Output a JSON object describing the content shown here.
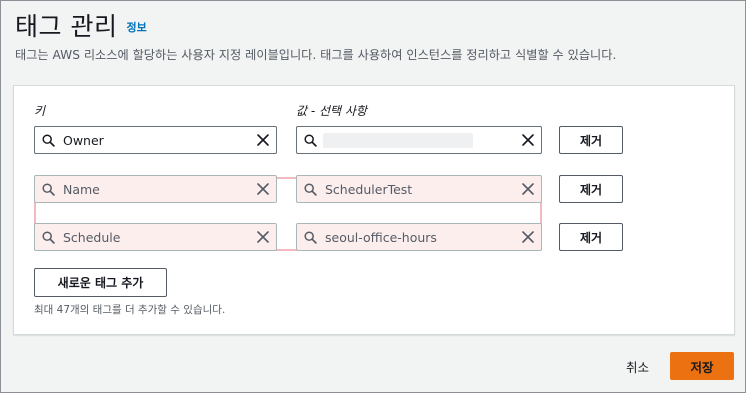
{
  "header": {
    "title": "태그 관리",
    "info_link": "정보",
    "description": "태그는 AWS 리소스에 할당하는 사용자 지정 레이블입니다. 태그를 사용하여 인스턴스를 정리하고 식별할 수 있습니다."
  },
  "columns": {
    "key": "키",
    "value": "값 - 선택 사항"
  },
  "tags": [
    {
      "key": "Owner",
      "value": "",
      "remove_label": "제거",
      "error": false
    },
    {
      "key": "Name",
      "value": "SchedulerTest",
      "remove_label": "제거",
      "error": true
    },
    {
      "key": "Schedule",
      "value": "seoul-office-hours",
      "remove_label": "제거",
      "error": true
    }
  ],
  "add_tag_label": "새로운 태그 추가",
  "limit_hint": "최대 47개의 태그를 더 추가할 수 있습니다.",
  "footer": {
    "cancel_label": "취소",
    "save_label": "저장"
  },
  "colors": {
    "accent": "#ec7211",
    "link": "#0073bb",
    "error_border": "#f3b9c1",
    "error_fill": "#fdeeee"
  },
  "icons": [
    "search-icon",
    "clear-icon"
  ]
}
